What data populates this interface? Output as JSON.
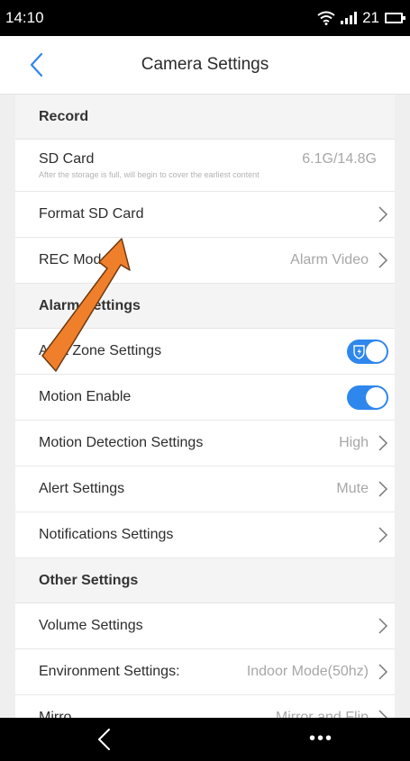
{
  "status": {
    "time": "14:10",
    "battery": "21"
  },
  "header": {
    "title": "Camera Settings"
  },
  "sections": [
    {
      "title": "Record",
      "rows": [
        {
          "label": "SD Card",
          "value": "6.1G/14.8G",
          "sub": "After the storage is full, will begin to cover the earliest content"
        },
        {
          "label": "Format SD Card",
          "value": ""
        },
        {
          "label": "REC Mode",
          "value": "Alarm Video"
        }
      ]
    },
    {
      "title": "Alarm Settings",
      "rows": [
        {
          "label": "Alert Zone Settings",
          "toggle": true
        },
        {
          "label": "Motion Enable",
          "toggle": true
        },
        {
          "label": "Motion Detection Settings",
          "value": "High"
        },
        {
          "label": "Alert Settings",
          "value": "Mute"
        },
        {
          "label": "Notifications Settings",
          "value": ""
        }
      ]
    },
    {
      "title": "Other Settings",
      "rows": [
        {
          "label": "Volume Settings",
          "value": ""
        },
        {
          "label": "Environment Settings:",
          "value": "Indoor Mode(50hz)"
        },
        {
          "label": "Mirro",
          "value": "Mirror and Flip"
        }
      ]
    }
  ],
  "colors": {
    "accent": "#2e87ec",
    "annotation_arrow": "#f07f2b"
  }
}
